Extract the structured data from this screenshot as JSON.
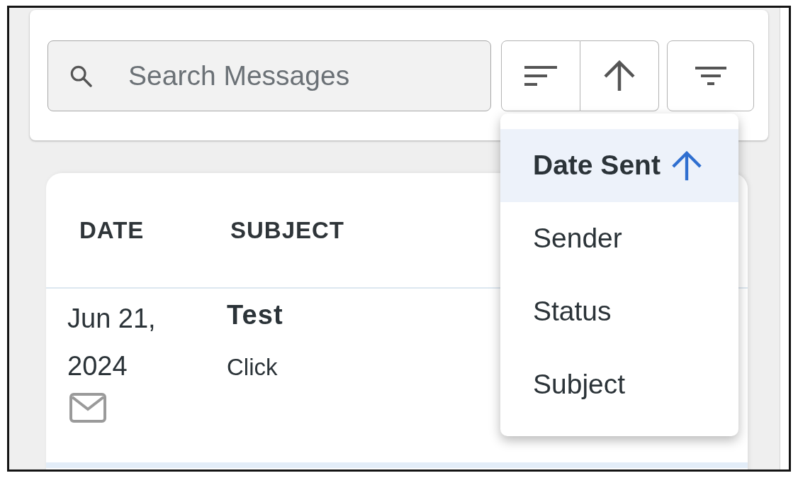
{
  "search": {
    "placeholder": "Search Messages"
  },
  "sort": {
    "ascending": true
  },
  "sort_menu": {
    "expanded": true,
    "items": [
      {
        "label": "Date Sent",
        "selected": true
      },
      {
        "label": "Sender",
        "selected": false
      },
      {
        "label": "Status",
        "selected": false
      },
      {
        "label": "Subject",
        "selected": false
      }
    ]
  },
  "table": {
    "columns": [
      "DATE",
      "SUBJECT"
    ],
    "rows": [
      {
        "date": "Jun 21, 2024",
        "subject": "Test",
        "preview": "Click"
      }
    ]
  }
}
